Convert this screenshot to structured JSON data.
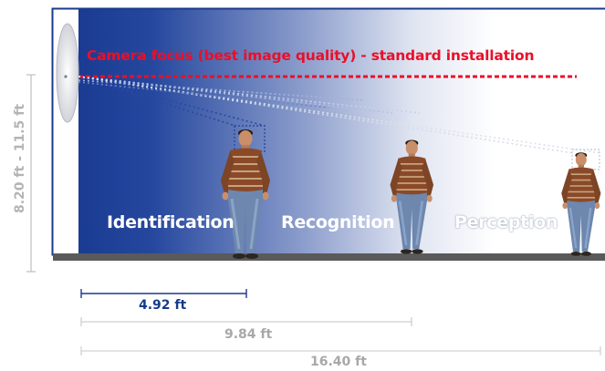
{
  "diagram": {
    "camera_focus_label": "Camera focus (best image quality) - standard installation",
    "zones": [
      {
        "label": "Identification"
      },
      {
        "label": "Recognition"
      },
      {
        "label": "Perception"
      }
    ],
    "height_label": "8.20 ft - 11.5 ft",
    "distances": [
      {
        "label": "4.92 ft",
        "color": "#163a8a"
      },
      {
        "label": "9.84 ft",
        "color": "#a8a8a8"
      },
      {
        "label": "16.40 ft",
        "color": "#a8a8a8"
      }
    ],
    "colors": {
      "focus_line": "#e8102a",
      "room_gradient_start": "#17378e",
      "room_gradient_end": "#ffffff",
      "floor": "#5a5a5a",
      "frame": "#1b3a8c"
    },
    "icons": [
      "camera-icon",
      "person-figure"
    ]
  }
}
